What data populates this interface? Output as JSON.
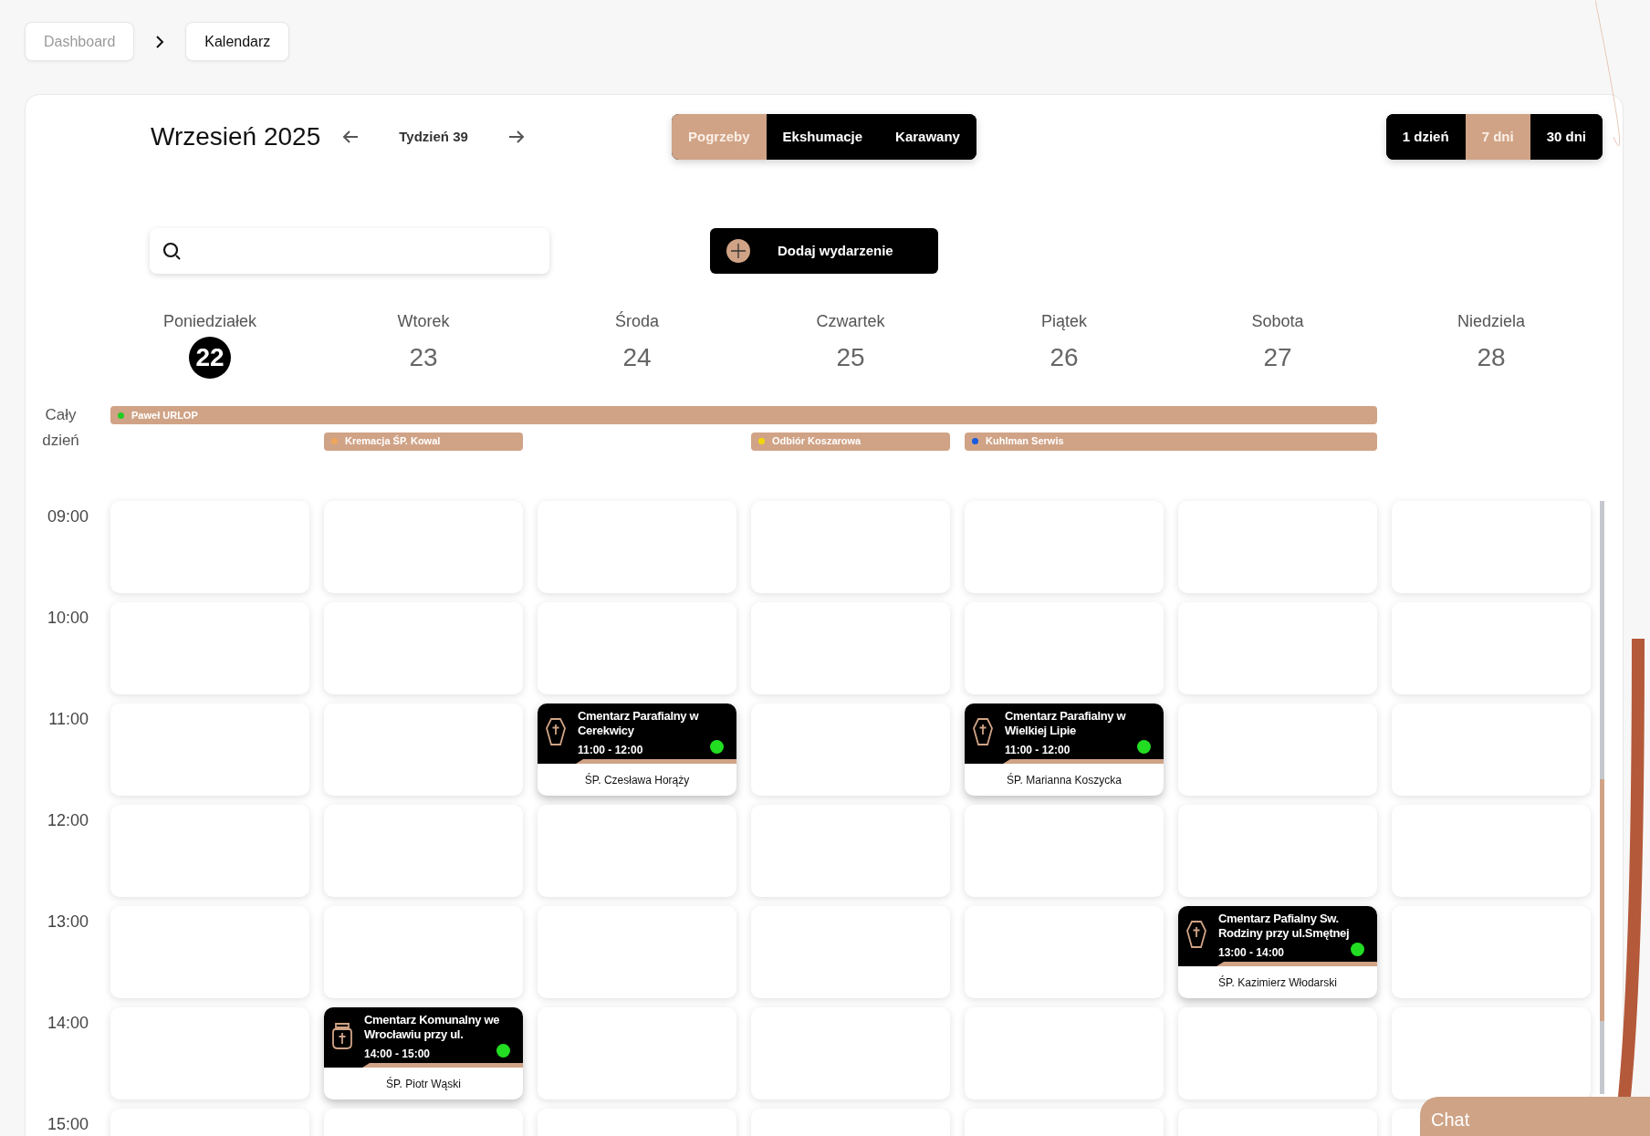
{
  "breadcrumb": [
    {
      "label": "Dashboard",
      "selected": false
    },
    {
      "label": "Kalendarz",
      "selected": true
    }
  ],
  "header": {
    "month": "Wrzesień 2025",
    "week": "Tydzień 39"
  },
  "categories": [
    {
      "label": "Pogrzeby",
      "selected": true
    },
    {
      "label": "Ekshumacje",
      "selected": false
    },
    {
      "label": "Karawany",
      "selected": false
    }
  ],
  "views": [
    {
      "label": "1 dzień",
      "selected": false
    },
    {
      "label": "7 dni",
      "selected": true
    },
    {
      "label": "30 dni",
      "selected": false
    }
  ],
  "add_button": "Dodaj wydarzenie",
  "days": [
    {
      "name": "Poniedziałek",
      "number": "22",
      "selected": true
    },
    {
      "name": "Wtorek",
      "number": "23",
      "selected": false
    },
    {
      "name": "Środa",
      "number": "24",
      "selected": false
    },
    {
      "name": "Czwartek",
      "number": "25",
      "selected": false
    },
    {
      "name": "Piątek",
      "number": "26",
      "selected": false
    },
    {
      "name": "Sobota",
      "number": "27",
      "selected": false
    },
    {
      "name": "Niedziela",
      "number": "28",
      "selected": false
    }
  ],
  "all_day": {
    "label": "Cały dzień",
    "lanes": [
      [
        {
          "kind": "start",
          "label": "Paweł URLOP",
          "color": "#22cc22"
        },
        {
          "kind": "continue"
        },
        {
          "kind": "continue"
        },
        {
          "kind": "continue"
        },
        {
          "kind": "continue"
        },
        {
          "kind": "continue"
        },
        {
          "kind": "empty"
        }
      ],
      [
        {
          "kind": "empty"
        },
        {
          "kind": "start",
          "label": "Kremacja ŚP. Kowal",
          "color": "#f0a65a"
        },
        {
          "kind": "empty"
        },
        {
          "kind": "start",
          "label": "Odbiór Koszarowa",
          "color": "#f2d60c"
        },
        {
          "kind": "start",
          "label": "Kuhlman Serwis",
          "color": "#1a5be0"
        },
        {
          "kind": "continue"
        },
        {
          "kind": "empty"
        }
      ]
    ]
  },
  "hours": [
    {
      "time": "09:00",
      "cells": [
        {
          "kind": "empty"
        },
        {
          "kind": "empty"
        },
        {
          "kind": "empty"
        },
        {
          "kind": "empty"
        },
        {
          "kind": "empty"
        },
        {
          "kind": "empty"
        },
        {
          "kind": "empty"
        }
      ]
    },
    {
      "time": "10:00",
      "cells": [
        {
          "kind": "empty"
        },
        {
          "kind": "empty"
        },
        {
          "kind": "empty"
        },
        {
          "kind": "empty"
        },
        {
          "kind": "empty"
        },
        {
          "kind": "empty"
        },
        {
          "kind": "empty"
        }
      ]
    },
    {
      "time": "11:00",
      "cells": [
        {
          "kind": "empty"
        },
        {
          "kind": "empty"
        },
        {
          "kind": "coffin",
          "title": "Cmentarz Parafialny w Cerekwicy",
          "time": "11:00 - 12:00",
          "person": "ŚP. Czesława Horąży",
          "color": "#22dd22"
        },
        {
          "kind": "empty"
        },
        {
          "kind": "coffin",
          "title": "Cmentarz Parafialny w Wielkiej Lipie",
          "time": "11:00 - 12:00",
          "person": "ŚP. Marianna Koszycka",
          "color": "#22dd22"
        },
        {
          "kind": "empty"
        },
        {
          "kind": "empty"
        }
      ]
    },
    {
      "time": "12:00",
      "cells": [
        {
          "kind": "empty"
        },
        {
          "kind": "empty"
        },
        {
          "kind": "empty"
        },
        {
          "kind": "empty"
        },
        {
          "kind": "empty"
        },
        {
          "kind": "empty"
        },
        {
          "kind": "empty"
        }
      ]
    },
    {
      "time": "13:00",
      "cells": [
        {
          "kind": "empty"
        },
        {
          "kind": "empty"
        },
        {
          "kind": "empty"
        },
        {
          "kind": "empty"
        },
        {
          "kind": "empty"
        },
        {
          "kind": "coffin",
          "title": "Cmentarz Pafialny Sw. Rodziny przy ul.Smętnej",
          "time": "13:00 - 14:00",
          "person": "ŚP. Kazimierz Włodarski",
          "color": "#22dd22"
        },
        {
          "kind": "empty"
        }
      ]
    },
    {
      "time": "14:00",
      "cells": [
        {
          "kind": "empty"
        },
        {
          "kind": "urn",
          "title": "Cmentarz Komunalny we Wrocławiu przy ul.",
          "time": "14:00 - 15:00",
          "person": "ŚP. Piotr Wąski",
          "color": "#22dd22"
        },
        {
          "kind": "empty"
        },
        {
          "kind": "empty"
        },
        {
          "kind": "empty"
        },
        {
          "kind": "empty"
        },
        {
          "kind": "empty"
        }
      ]
    },
    {
      "time": "15:00",
      "cells": [
        {
          "kind": "empty"
        },
        {
          "kind": "empty"
        },
        {
          "kind": "empty"
        },
        {
          "kind": "empty"
        },
        {
          "kind": "empty"
        },
        {
          "kind": "empty"
        },
        {
          "kind": "empty"
        }
      ]
    }
  ],
  "chat": "Chat"
}
